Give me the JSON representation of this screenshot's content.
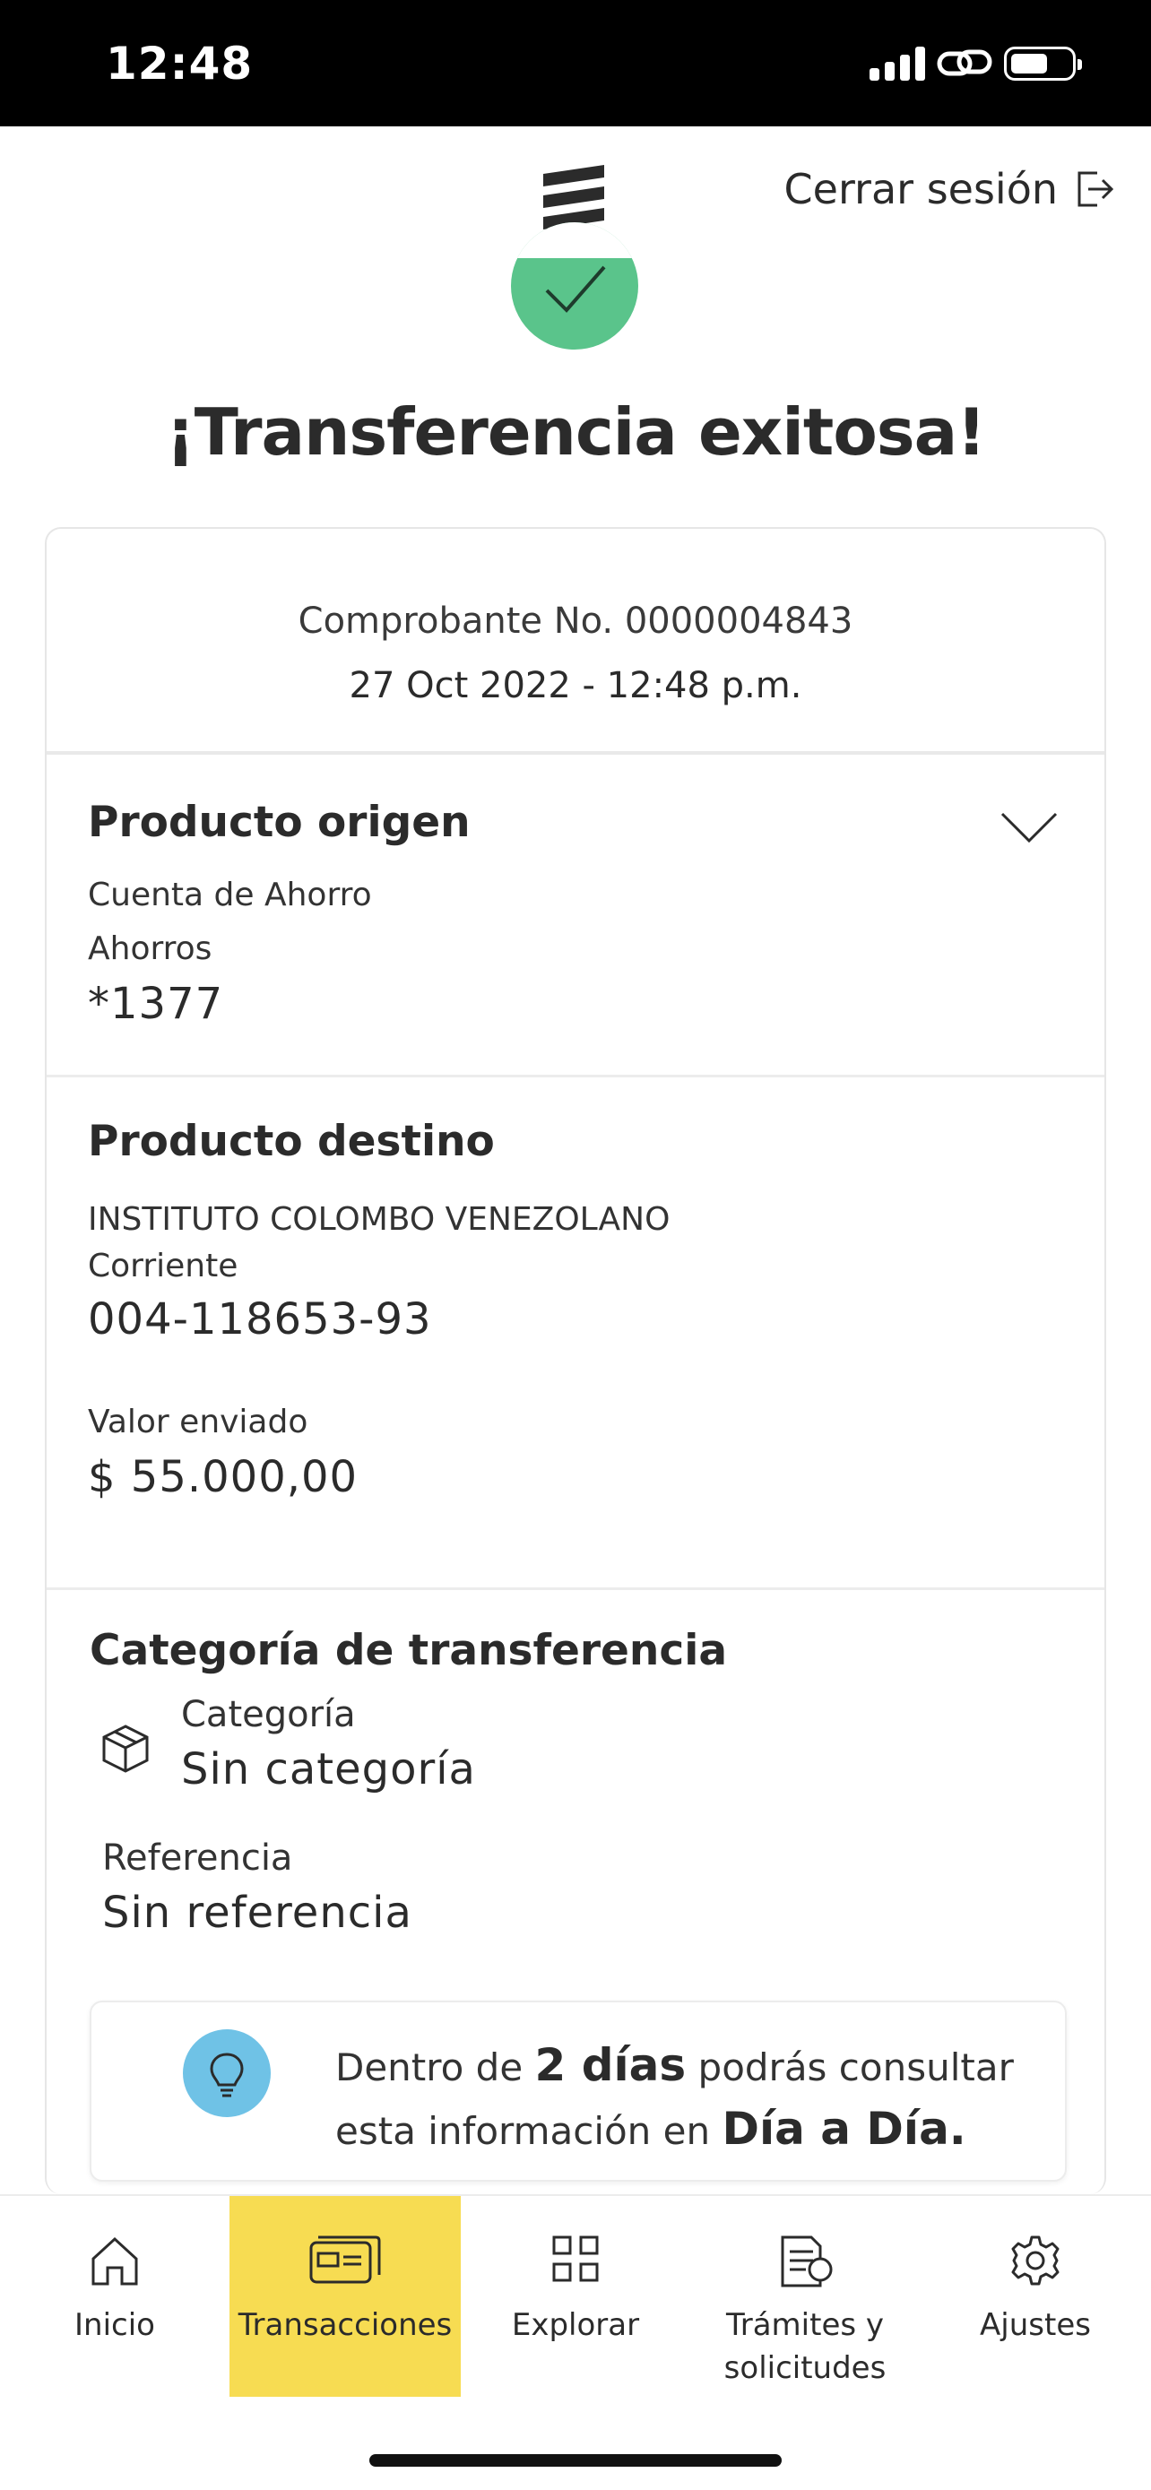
{
  "status_bar": {
    "time": "12:48"
  },
  "header": {
    "logout_label": "Cerrar sesión"
  },
  "title": "¡Transferencia exitosa!",
  "receipt": {
    "number_label": "Comprobante No. 0000004843",
    "datetime": "27 Oct 2022 - 12:48 p.m."
  },
  "origin": {
    "title": "Producto origen",
    "account_type": "Cuenta de Ahorro",
    "subtype": "Ahorros",
    "account_number": "*1377"
  },
  "destination": {
    "title": "Producto destino",
    "name": "INSTITUTO COLOMBO VENEZOLANO",
    "account_type": "Corriente",
    "account_number": "004-118653-93",
    "amount_label": "Valor enviado",
    "amount": "$ 55.000,00"
  },
  "category": {
    "title": "Categoría de transferencia",
    "category_label": "Categoría",
    "category_value": "Sin categoría",
    "reference_label": "Referencia",
    "reference_value": "Sin referencia"
  },
  "info": {
    "text_1": "Dentro de",
    "highlight_1": "2 días",
    "text_2": "podrás consultar",
    "text_3": "esta información en",
    "highlight_2": "Día a Día."
  },
  "tabs": [
    {
      "label": "Inicio",
      "icon": "home-icon"
    },
    {
      "label": "Transacciones",
      "icon": "transactions-icon",
      "active": true
    },
    {
      "label": "Explorar",
      "icon": "grid-icon"
    },
    {
      "label_line1": "Trámites y",
      "label_line2": "solicitudes",
      "icon": "documents-icon"
    },
    {
      "label": "Ajustes",
      "icon": "gear-icon"
    }
  ],
  "colors": {
    "success": "#5ac48b",
    "active_tab": "#f7dc52",
    "info_icon": "#6fc2e6"
  }
}
